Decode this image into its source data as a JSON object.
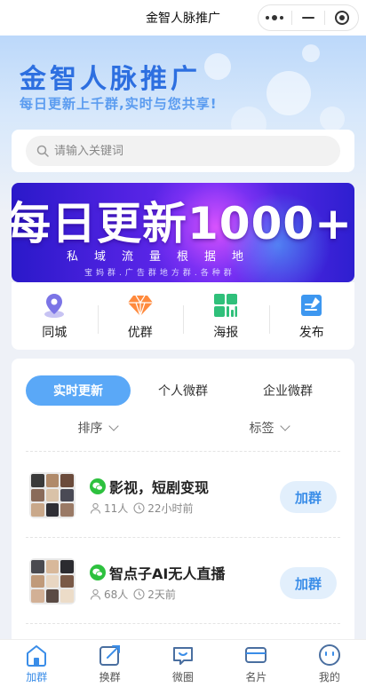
{
  "navbar": {
    "title": "金智人脉推广"
  },
  "hero": {
    "title": "金智人脉推广",
    "subtitle": "每日更新上千群,实时与您共享!"
  },
  "search": {
    "placeholder": "请输入关键词"
  },
  "banner": {
    "headline": "每日更新1000+",
    "line2": "私域流量根据地",
    "line3": "宝妈群.广告群地方群.各种群"
  },
  "quick_actions": [
    {
      "label": "同城",
      "icon": "location-pin-icon"
    },
    {
      "label": "优群",
      "icon": "diamond-icon"
    },
    {
      "label": "海报",
      "icon": "poster-grid-icon"
    },
    {
      "label": "发布",
      "icon": "edit-note-icon"
    }
  ],
  "tabs": [
    {
      "label": "实时更新",
      "active": true
    },
    {
      "label": "个人微群",
      "active": false
    },
    {
      "label": "企业微群",
      "active": false
    }
  ],
  "filters": {
    "sort": "排序",
    "tags": "标签"
  },
  "groups": [
    {
      "name": "影视，短剧变现",
      "members": "11人",
      "time": "22小时前",
      "join": "加群"
    },
    {
      "name": "智点子AI无人直播",
      "members": "68人",
      "time": "2天前",
      "join": "加群"
    }
  ],
  "tabbar": [
    {
      "label": "加群",
      "icon": "home-icon",
      "active": true
    },
    {
      "label": "换群",
      "icon": "exchange-icon",
      "active": false
    },
    {
      "label": "微圈",
      "icon": "chat-bubble-icon",
      "active": false
    },
    {
      "label": "名片",
      "icon": "card-icon",
      "active": false
    },
    {
      "label": "我的",
      "icon": "profile-face-icon",
      "active": false
    }
  ],
  "colors": {
    "accent": "#3a8de8",
    "tab_active_bg": "#5aa8f7",
    "join_bg": "#e2effc",
    "wechat_green": "#2dc13e"
  }
}
